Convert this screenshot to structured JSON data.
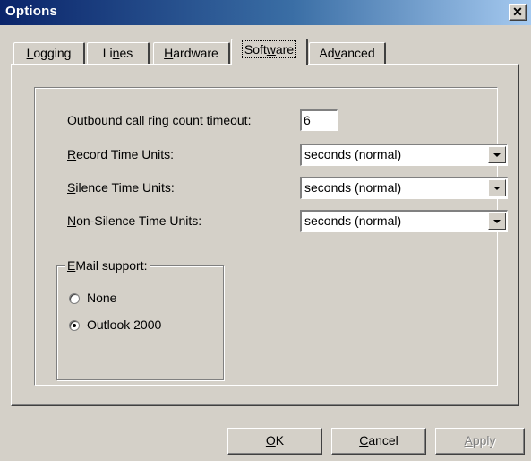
{
  "window": {
    "title": "Options"
  },
  "tabs": [
    {
      "label_pre": "",
      "label_key": "L",
      "label_post": "ogging"
    },
    {
      "label_pre": "Li",
      "label_key": "n",
      "label_post": "es"
    },
    {
      "label_pre": "",
      "label_key": "H",
      "label_post": "ardware"
    },
    {
      "label_pre": "Soft",
      "label_key": "w",
      "label_post": "are",
      "active": true
    },
    {
      "label_pre": "Ad",
      "label_key": "v",
      "label_post": "anced"
    }
  ],
  "software": {
    "ring_timeout": {
      "label_pre": "Outbound call ring count ",
      "label_key": "t",
      "label_post": "imeout:",
      "value": "6"
    },
    "record_units": {
      "label_pre": "",
      "label_key": "R",
      "label_post": "ecord Time Units:",
      "value": "seconds (normal)"
    },
    "silence_units": {
      "label_pre": "",
      "label_key": "S",
      "label_post": "ilence Time Units:",
      "value": "seconds (normal)"
    },
    "nonsilence_units": {
      "label_pre": "",
      "label_key": "N",
      "label_post": "on-Silence Time Units:",
      "value": "seconds (normal)"
    },
    "email": {
      "legend_pre": "",
      "legend_key": "E",
      "legend_post": "Mail support:",
      "options": [
        {
          "label": "None",
          "checked": false
        },
        {
          "label": "Outlook 2000",
          "checked": true
        }
      ]
    }
  },
  "buttons": {
    "ok": {
      "key": "O",
      "post": "K"
    },
    "cancel": {
      "key": "C",
      "post": "ancel"
    },
    "apply": {
      "pre": "",
      "key": "A",
      "post": "pply",
      "disabled": true
    }
  }
}
